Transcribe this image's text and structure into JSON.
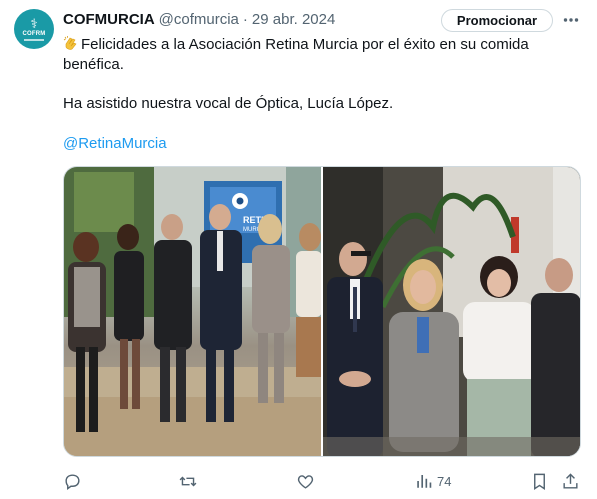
{
  "account": {
    "name": "COFMURCIA",
    "handle": "@cofmurcia",
    "separator": "·",
    "date": "29 abr. 2024",
    "avatar_text": "COFRM"
  },
  "buttons": {
    "promote_label": "Promocionar"
  },
  "tweet": {
    "line1": "Felicidades a la Asociación Retina Murcia por el éxito en su comida",
    "line2": "benéfica.",
    "line3": "Ha asistido nuestra vocal de Óptica, Lucía López.",
    "mention": "@RetinaMurcia"
  },
  "media": {
    "banner_text_1": "RETINA",
    "banner_text_2": "MURCIA"
  },
  "stats": {
    "views": "74"
  },
  "icons": {
    "emoji": "clapping-hands-icon",
    "more": "more-icon",
    "reply": "reply-icon",
    "retweet": "retweet-icon",
    "like": "like-icon",
    "views": "views-icon",
    "bookmark": "bookmark-icon",
    "share": "share-icon"
  },
  "colors": {
    "avatar_bg": "#1a9aa6",
    "link": "#1d9bf0",
    "secondary_text": "#536471",
    "border": "#cfd9de"
  }
}
